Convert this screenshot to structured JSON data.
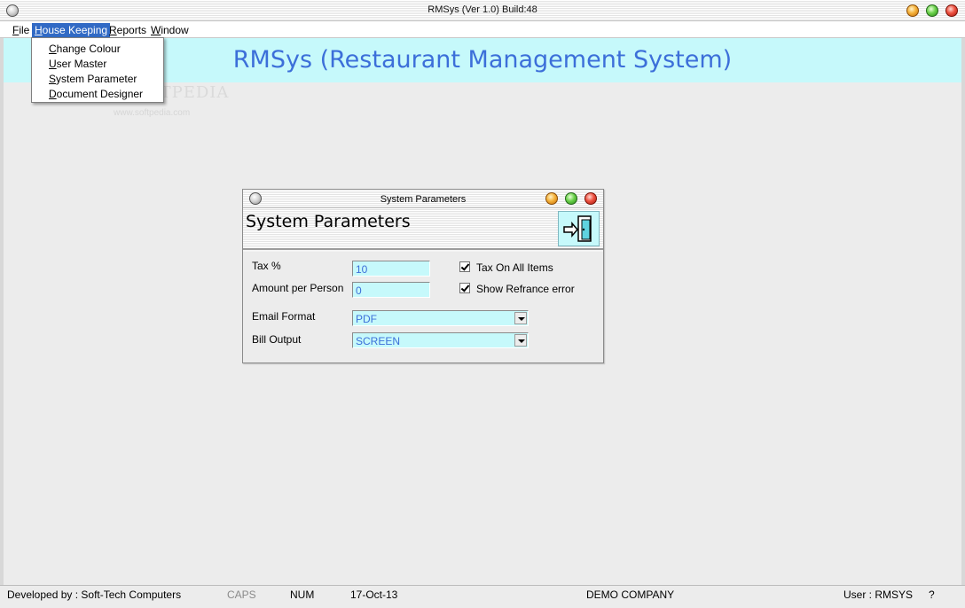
{
  "window": {
    "title": "RMSys (Ver 1.0) Build:48"
  },
  "menubar": {
    "items": [
      {
        "mnemonic": "F",
        "rest": "ile"
      },
      {
        "mnemonic": "H",
        "rest": "ouse Keeping"
      },
      {
        "mnemonic": "R",
        "rest": "eports"
      },
      {
        "mnemonic": "W",
        "rest": "indow"
      }
    ]
  },
  "dropdown": {
    "items": [
      {
        "mnemonic": "C",
        "rest": "hange Colour"
      },
      {
        "mnemonic": "U",
        "rest": "ser Master"
      },
      {
        "mnemonic": "S",
        "rest": "ystem Parameter"
      },
      {
        "mnemonic": "D",
        "rest": "ocument Designer"
      }
    ]
  },
  "banner": {
    "title": "RMSys (Restaurant Management System)"
  },
  "watermark": {
    "main": "SOFTPEDIA",
    "sub": "www.softpedia.com"
  },
  "dialog": {
    "window_title": "System Parameters",
    "heading": "System Parameters",
    "tax": {
      "label": "Tax %",
      "value": "10"
    },
    "amount_per_person": {
      "label": "Amount per Person",
      "value": "0"
    },
    "tax_on_all_items": {
      "label": "Tax On All Items",
      "checked": true
    },
    "show_refrance_error": {
      "label": "Show Refrance error",
      "checked": true
    },
    "email_format": {
      "label": "Email Format",
      "value": "PDF"
    },
    "bill_output": {
      "label": "Bill Output",
      "value": "SCREEN"
    }
  },
  "statusbar": {
    "developer": "Developed by : Soft-Tech Computers",
    "caps": "CAPS",
    "num": "NUM",
    "date": "17-Oct-13",
    "company": "DEMO COMPANY",
    "user": "User : RMSYS",
    "help": "?"
  },
  "colors": {
    "banner_bg": "#c6f9fb",
    "banner_text": "#3c6fd9",
    "menu_highlight": "#316ac5",
    "field_bg": "#c6f9fb",
    "field_text": "#3c6fd9"
  },
  "icons": {
    "system_menu": "grey-orb-icon",
    "minimize": "orange-orb-icon",
    "maximize": "green-orb-icon",
    "close": "red-orb-icon",
    "exit": "exit-door-icon"
  }
}
